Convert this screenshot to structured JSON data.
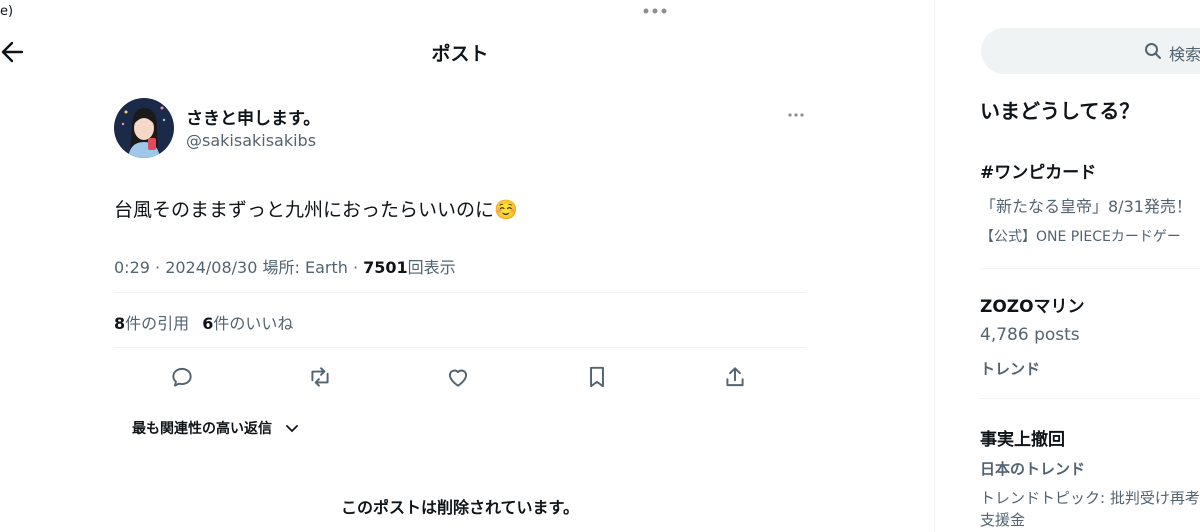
{
  "top_left_fragment": "e)",
  "header": {
    "title": "ポスト"
  },
  "post": {
    "display_name": "さきと申します。",
    "handle": "@sakisakisakibs",
    "text": "台風そのままずっと九州におったらいいのに",
    "emoji": "☺️",
    "meta": {
      "time": "0:29 · 2024/08/30 場所: Earth · ",
      "views_count": "7501",
      "views_label": "回表示"
    },
    "stats": {
      "quotes_count": "8",
      "quotes_label": "件の引用",
      "likes_count": "6",
      "likes_label": "件のいいね"
    }
  },
  "replies_sort": {
    "label": "最も関連性の高い返信"
  },
  "deleted_notice": "このポストは削除されています。",
  "sidebar": {
    "search_placeholder": "検索",
    "trends_title": "いまどうしてる？",
    "trends": [
      {
        "name": "#ワンピカード",
        "promo_line": "「新たなる皇帝」8/31発売！",
        "promoter": "【公式】ONE PIECEカードゲー"
      },
      {
        "name": "ZOZOマリン",
        "posts": "4,786 posts",
        "context": "トレンド"
      },
      {
        "name": "事実上撤回",
        "context": "日本のトレンド",
        "topic": "トレンドトピック: 批判受け再考",
        "topic2": "支援金"
      }
    ]
  },
  "colors": {
    "accent": "#1d9bf0",
    "text": "#0f1419",
    "muted": "#536471",
    "divider": "#eff3f4"
  }
}
